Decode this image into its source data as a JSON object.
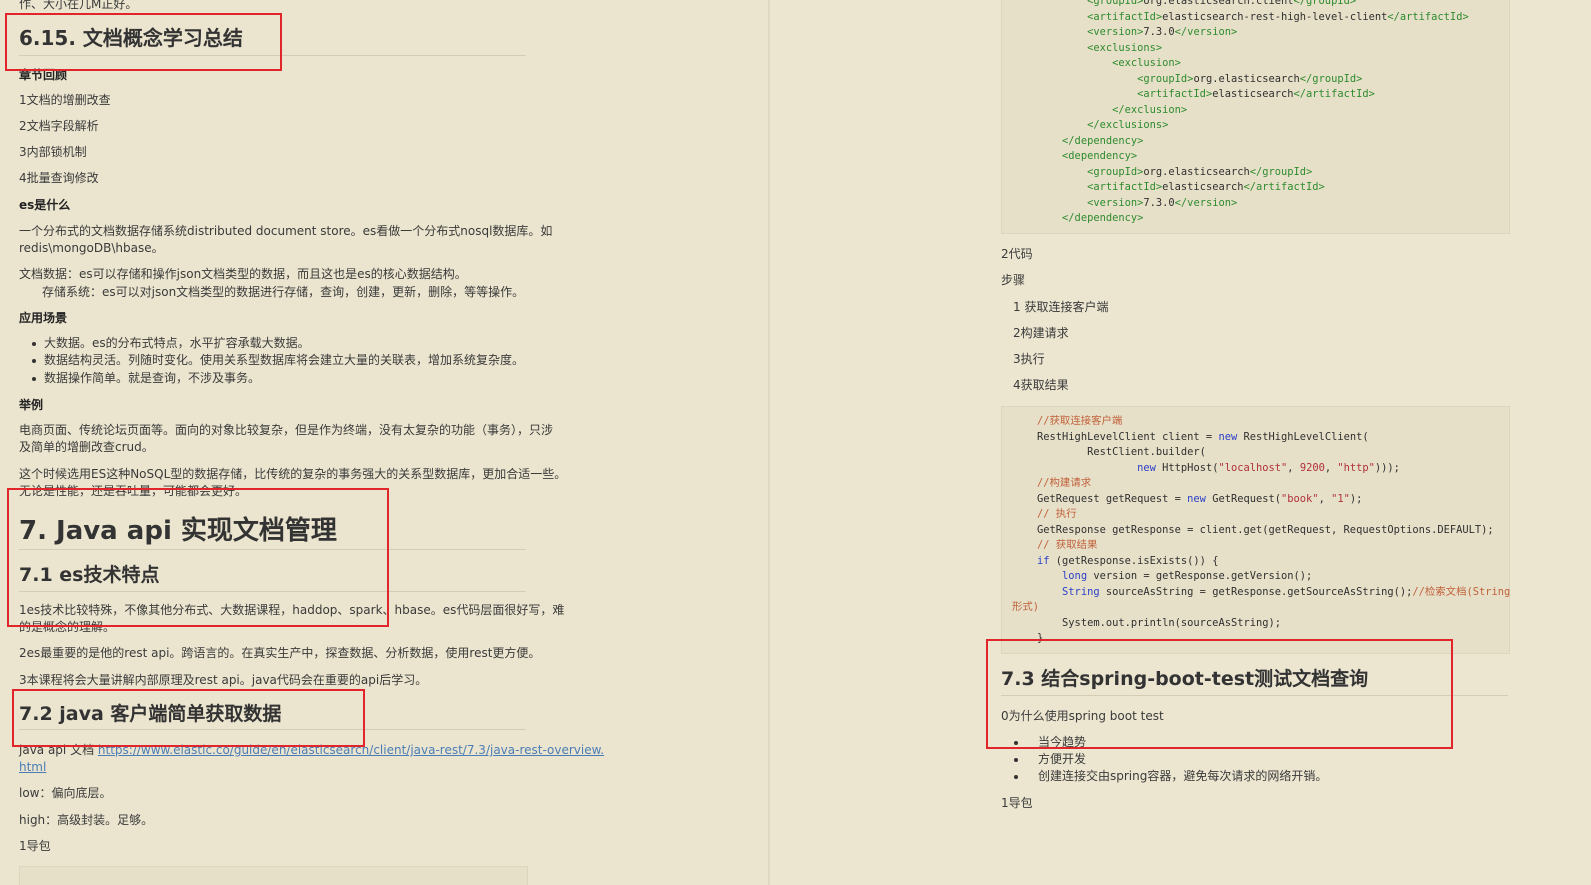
{
  "left": {
    "top_fragment": "作、大小在几M正好。",
    "heading_615": "6.15.   文档概念学习总结",
    "review_title": "章节回顾",
    "review_items": [
      "1文档的增删改查",
      "2文档字段解析",
      "3内部锁机制",
      "4批量查询修改"
    ],
    "what_es_title": "es是什么",
    "what_es_p1_l1": "一个分布式的文档数据存储系统distributed document store。es看做一个分布式nosql数据库。如",
    "what_es_p1_l2": "redis\\mongoDB\\hbase。",
    "what_es_p2_l1": "文档数据：es可以存储和操作json文档类型的数据，而且这也是es的核心数据结构。",
    "what_es_p2_l2": "存储系统：es可以对json文档类型的数据进行存储，查询，创建，更新，删除，等等操作。",
    "scene_title": "应用场景",
    "scene_items": [
      "大数据。es的分布式特点，水平扩容承载大数据。",
      "数据结构灵活。列随时变化。使用关系型数据库将会建立大量的关联表，增加系统复杂度。",
      "数据操作简单。就是查询，不涉及事务。"
    ],
    "example_title": "举例",
    "example_p1_l1": "电商页面、传统论坛页面等。面向的对象比较复杂，但是作为终端，没有太复杂的功能（事务），只涉",
    "example_p1_l2": "及简单的增删改查crud。",
    "example_p2_l1": "这个时候选用ES这种NoSQL型的数据存储，比传统的复杂的事务强大的关系型数据库，更加合适一些。",
    "example_p2_l2": "无论是性能，还是吞吐量，可能都会更好。",
    "heading_7": "7.   Java api 实现文档管理",
    "heading_71": "7.1 es技术特点",
    "tech_p1_l1": "1es技术比较特殊，不像其他分布式、大数据课程，haddop、spark、hbase。es代码层面很好写，难",
    "tech_p1_l2": "的是概念的理解。",
    "tech_p2": "2es最重要的是他的rest api。跨语言的。在真实生产中，探查数据、分析数据，使用rest更方便。",
    "tech_p3": "3本课程将会大量讲解内部原理及rest api。java代码会在重要的api后学习。",
    "heading_72": "7.2 java 客户端简单获取数据",
    "api_doc_label": "java api 文档 ",
    "api_doc_link_l1": "https://www.elastic.co/guide/en/elasticsearch/client/java-rest/7.3/java-rest-overview.",
    "api_doc_link_l2": "html",
    "low_text": "low：偏向底层。",
    "high_text": "high：高级封装。足够。",
    "import_text": "1导包"
  },
  "right": {
    "xml_lines": [
      {
        "indent": 3,
        "open": "<groupId>",
        "text": "org.elasticsearch.client",
        "close": "</groupId>"
      },
      {
        "indent": 3,
        "open": "<artifactId>",
        "text": "elasticsearch-rest-high-level-client",
        "close": "</artifactId>"
      },
      {
        "indent": 3,
        "open": "<version>",
        "text": "7.3.0",
        "close": "</version>"
      },
      {
        "indent": 3,
        "open": "<exclusions>",
        "text": "",
        "close": ""
      },
      {
        "indent": 4,
        "open": "<exclusion>",
        "text": "",
        "close": ""
      },
      {
        "indent": 5,
        "open": "<groupId>",
        "text": "org.elasticsearch",
        "close": "</groupId>"
      },
      {
        "indent": 5,
        "open": "<artifactId>",
        "text": "elasticsearch",
        "close": "</artifactId>"
      },
      {
        "indent": 4,
        "open": "</exclusion>",
        "text": "",
        "close": ""
      },
      {
        "indent": 3,
        "open": "</exclusions>",
        "text": "",
        "close": ""
      },
      {
        "indent": 2,
        "open": "</dependency>",
        "text": "",
        "close": ""
      },
      {
        "indent": 2,
        "open": "<dependency>",
        "text": "",
        "close": ""
      },
      {
        "indent": 3,
        "open": "<groupId>",
        "text": "org.elasticsearch",
        "close": "</groupId>"
      },
      {
        "indent": 3,
        "open": "<artifactId>",
        "text": "elasticsearch",
        "close": "</artifactId>"
      },
      {
        "indent": 3,
        "open": "<version>",
        "text": "7.3.0",
        "close": "</version>"
      },
      {
        "indent": 2,
        "open": "</dependency>",
        "text": "",
        "close": ""
      }
    ],
    "code_title": "2代码",
    "steps_title": "步骤",
    "steps": [
      "1 获取连接客户端",
      "2构建请求",
      "3执行",
      "4获取结果"
    ],
    "heading_73": "7.3 结合spring-boot-test测试文档查询",
    "why_text": "0为什么使用spring boot test",
    "why_items": [
      "当今趋势",
      "方便开发",
      "创建连接交由spring容器，避免每次请求的网络开销。"
    ],
    "import_text": "1导包"
  },
  "colors": {
    "background": "#ebe5cf",
    "highlight_border": "#e0262b",
    "xml_tag": "#2e8b2e",
    "keyword": "#2b40c7",
    "string": "#b0303a",
    "comment": "#c0613a",
    "link": "#4a7db5"
  }
}
